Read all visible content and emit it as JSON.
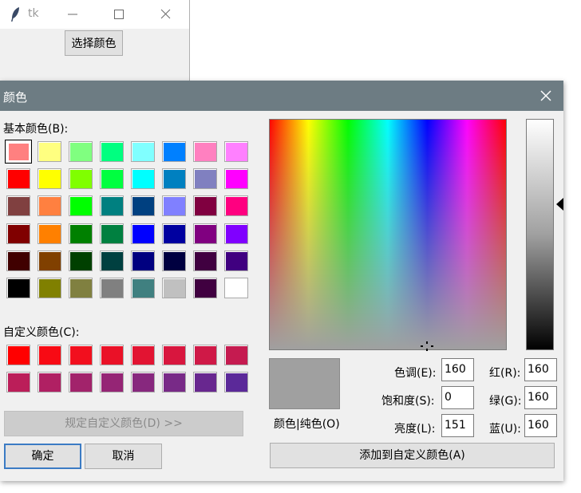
{
  "root_window": {
    "title": "tk",
    "button_label": "选择颜色"
  },
  "dialog": {
    "title": "颜色",
    "basic_colors_label": "基本颜色(B):",
    "basic_colors": [
      [
        "#ff8080",
        "#ffff80",
        "#80ff80",
        "#00ff80",
        "#80ffff",
        "#0080ff",
        "#ff80c0",
        "#ff80ff"
      ],
      [
        "#ff0000",
        "#ffff00",
        "#80ff00",
        "#00ff40",
        "#00ffff",
        "#0080c0",
        "#8080c0",
        "#ff00ff"
      ],
      [
        "#804040",
        "#ff8040",
        "#00ff00",
        "#008080",
        "#004080",
        "#8080ff",
        "#800040",
        "#ff0080"
      ],
      [
        "#800000",
        "#ff8000",
        "#008000",
        "#008040",
        "#0000ff",
        "#0000a0",
        "#800080",
        "#8000ff"
      ],
      [
        "#400000",
        "#804000",
        "#004000",
        "#004040",
        "#000080",
        "#000040",
        "#400040",
        "#400080"
      ],
      [
        "#000000",
        "#808000",
        "#808040",
        "#808080",
        "#408080",
        "#c0c0c0",
        "#400040",
        "#ffffff"
      ]
    ],
    "selected_basic": [
      0,
      0
    ],
    "custom_colors_label": "自定义颜色(C):",
    "custom_colors": [
      [
        "#ff0000",
        "#f80a14",
        "#f20f1e",
        "#ea1127",
        "#e21432",
        "#d8163e",
        "#cf1947",
        "#c51b50"
      ],
      [
        "#bb1e59",
        "#b02063",
        "#a2236b",
        "#952575",
        "#87287e",
        "#782a87",
        "#68278f",
        "#5b2999"
      ]
    ],
    "define_custom_label": "规定自定义颜色(D) >>",
    "ok_label": "确定",
    "cancel_label": "取消",
    "color_solid_label": "颜色|纯色(O)",
    "preview_color": "#a0a0a0",
    "hue_label": "色调(E):",
    "hue_value": "160",
    "sat_label": "饱和度(S):",
    "sat_value": "0",
    "lum_label": "亮度(L):",
    "lum_value": "151",
    "red_label": "红(R):",
    "red_value": "160",
    "green_label": "绿(G):",
    "green_value": "160",
    "blue_label": "蓝(U):",
    "blue_value": "160",
    "add_custom_label": "添加到自定义颜色(A)"
  }
}
